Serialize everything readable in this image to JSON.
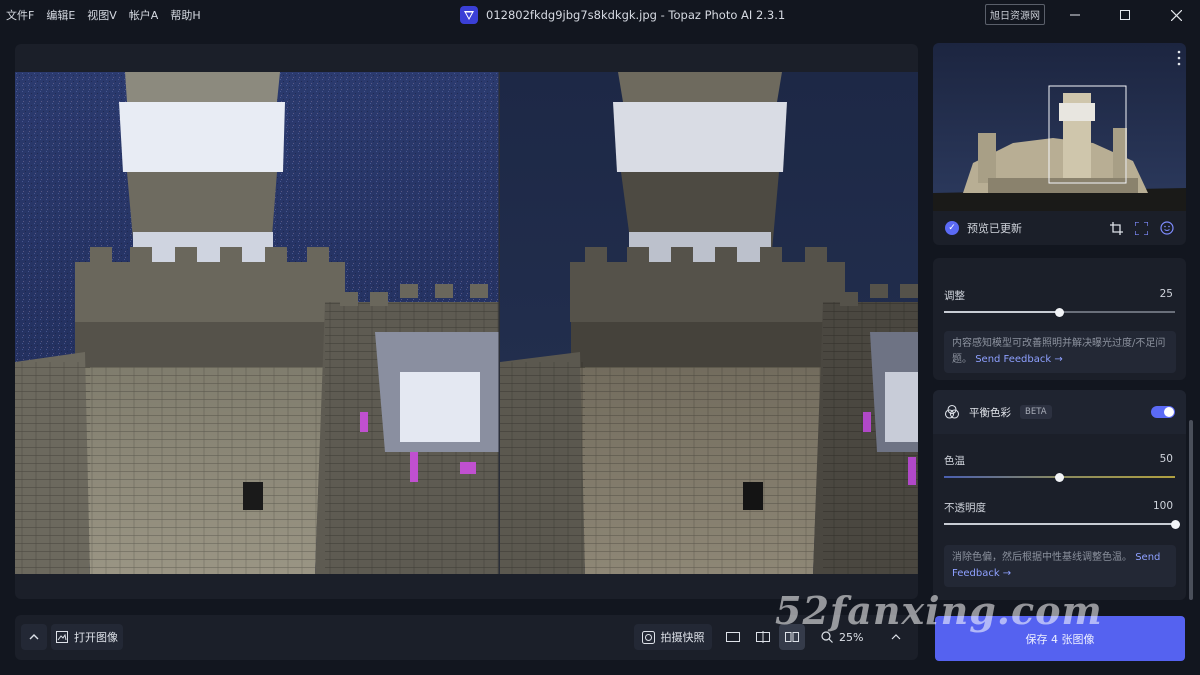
{
  "menu": [
    "文件F",
    "编辑E",
    "视图V",
    "帐户A",
    "帮助H"
  ],
  "window": {
    "title": "012802fkdg9jbg7s8kdkgk.jpg - Topaz Photo AI 2.3.1",
    "site_badge": "旭日资源网"
  },
  "navigator": {
    "status": "预览已更新"
  },
  "adjust_panel": {
    "label": "调整",
    "value": "25",
    "value_fraction": 0.5,
    "info": "内容感知模型可改善照明并解决曝光过度/不足问题。",
    "feedback": "Send Feedback →"
  },
  "balance_panel": {
    "title": "平衡色彩",
    "beta": "BETA",
    "enabled": true,
    "temp_label": "色温",
    "temp_value": "50",
    "temp_fraction": 0.5,
    "opacity_label": "不透明度",
    "opacity_value": "100",
    "opacity_fraction": 1.0,
    "info": "消除色偏，然后根据中性基线调整色温。",
    "feedback": "Send Feedback →"
  },
  "bottombar": {
    "open_image": "打开图像",
    "snapshot": "拍摄快照",
    "zoom": "25%"
  },
  "save_button": "保存 4 张图像",
  "watermark": "52fanxing.com",
  "colors": {
    "accent": "#5b6af5",
    "save": "#5562f0"
  }
}
